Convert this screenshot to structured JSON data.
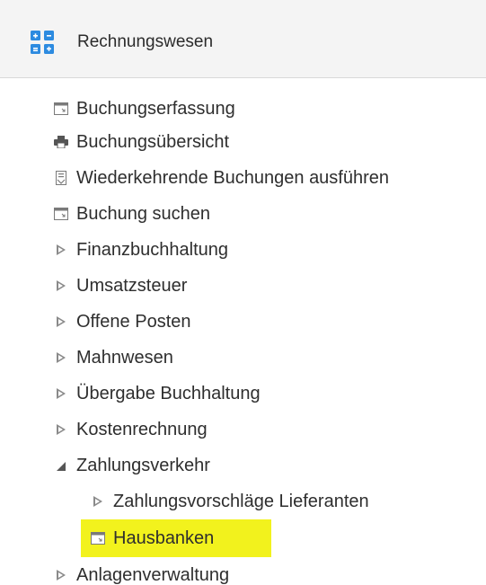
{
  "header": {
    "title": "Rechnungswesen",
    "icon": "grid-icon",
    "icon_color": "#2d8be0",
    "background": "#f4f4f4"
  },
  "menu": {
    "items": [
      {
        "label": "Buchungserfassung",
        "icon": "window-icon",
        "level": 1
      },
      {
        "label": "Buchungsübersicht",
        "icon": "printer-icon",
        "level": 1
      },
      {
        "label": "Wiederkehrende Buchungen ausführen",
        "icon": "document-icon",
        "level": 1
      },
      {
        "label": "Buchung suchen",
        "icon": "window-icon",
        "level": 1
      },
      {
        "label": "Finanzbuchhaltung",
        "icon": "collapsed-arrow-icon",
        "level": 1
      },
      {
        "label": "Umsatzsteuer",
        "icon": "collapsed-arrow-icon",
        "level": 1
      },
      {
        "label": "Offene Posten",
        "icon": "collapsed-arrow-icon",
        "level": 1
      },
      {
        "label": "Mahnwesen",
        "icon": "collapsed-arrow-icon",
        "level": 1
      },
      {
        "label": "Übergabe Buchhaltung",
        "icon": "collapsed-arrow-icon",
        "level": 1
      },
      {
        "label": "Kostenrechnung",
        "icon": "collapsed-arrow-icon",
        "level": 1
      },
      {
        "label": "Zahlungsverkehr",
        "icon": "expanded-arrow-icon",
        "level": 1
      },
      {
        "label": "Zahlungsvorschläge Lieferanten",
        "icon": "collapsed-arrow-icon",
        "level": 2
      },
      {
        "label": "Hausbanken",
        "icon": "window-icon",
        "level": 2,
        "highlighted": true
      },
      {
        "label": "Anlagenverwaltung",
        "icon": "collapsed-arrow-icon",
        "level": 1
      }
    ]
  },
  "colors": {
    "highlight": "#f2f21d",
    "text": "#2e2e2e",
    "icon_gray": "#8a8a8a"
  }
}
